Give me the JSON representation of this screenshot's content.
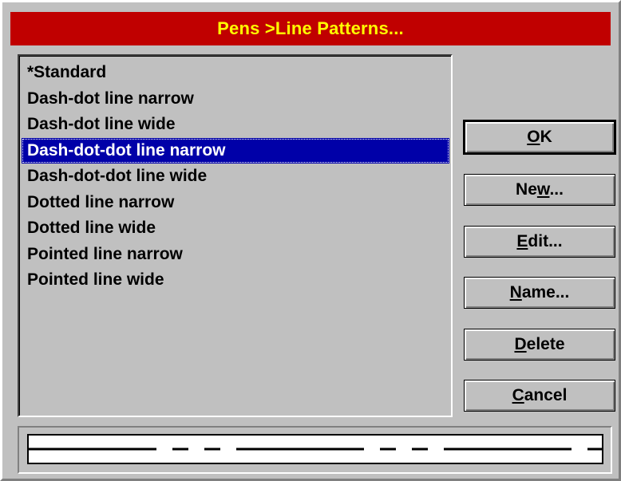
{
  "dialog": {
    "title": "Pens >Line Patterns..."
  },
  "list": {
    "items": [
      {
        "label": "*Standard",
        "selected": false
      },
      {
        "label": "Dash-dot line narrow",
        "selected": false
      },
      {
        "label": "Dash-dot line wide",
        "selected": false
      },
      {
        "label": "Dash-dot-dot line narrow",
        "selected": true
      },
      {
        "label": "Dash-dot-dot line wide",
        "selected": false
      },
      {
        "label": "Dotted line narrow",
        "selected": false
      },
      {
        "label": "Dotted line wide",
        "selected": false
      },
      {
        "label": "Pointed line narrow",
        "selected": false
      },
      {
        "label": "Pointed line wide",
        "selected": false
      }
    ]
  },
  "buttons": {
    "ok": {
      "pre": "",
      "ul": "O",
      "post": "K"
    },
    "new": {
      "pre": "Ne",
      "ul": "w",
      "post": "..."
    },
    "edit": {
      "pre": "",
      "ul": "E",
      "post": "dit..."
    },
    "name": {
      "pre": "",
      "ul": "N",
      "post": "ame..."
    },
    "delete": {
      "pre": "",
      "ul": "D",
      "post": "elete"
    },
    "cancel": {
      "pre": "",
      "ul": "C",
      "post": "ancel"
    }
  },
  "colors": {
    "title_bar": "#c00000",
    "title_text": "#ffff00",
    "selection": "#0000a8",
    "face": "#c0c0c0"
  }
}
